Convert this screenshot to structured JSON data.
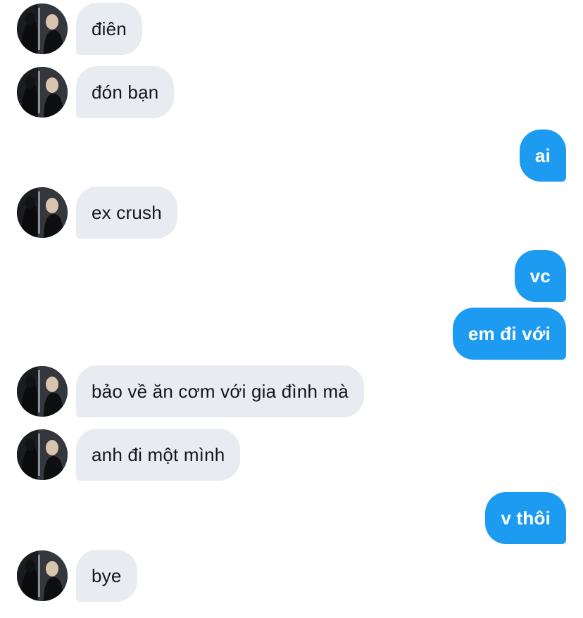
{
  "conversation": {
    "messages": [
      {
        "sender": "them",
        "text": "điên"
      },
      {
        "sender": "them",
        "text": "đón bạn"
      },
      {
        "sender": "me",
        "text": "ai"
      },
      {
        "sender": "them",
        "text": "ex crush"
      },
      {
        "sender": "me",
        "text": "vc"
      },
      {
        "sender": "me",
        "text": "em đi với"
      },
      {
        "sender": "them",
        "text": "bảo về ăn cơm với gia đình mà"
      },
      {
        "sender": "them",
        "text": "anh đi một mình"
      },
      {
        "sender": "me",
        "text": "v thôi"
      },
      {
        "sender": "them",
        "text": "bye"
      }
    ]
  },
  "colors": {
    "incoming_bubble": "#e8ebf0",
    "incoming_text": "#14171a",
    "outgoing_bubble": "#1d9bf0",
    "outgoing_text": "#ffffff"
  },
  "icons": {
    "avatar": "contact-avatar-photo"
  }
}
